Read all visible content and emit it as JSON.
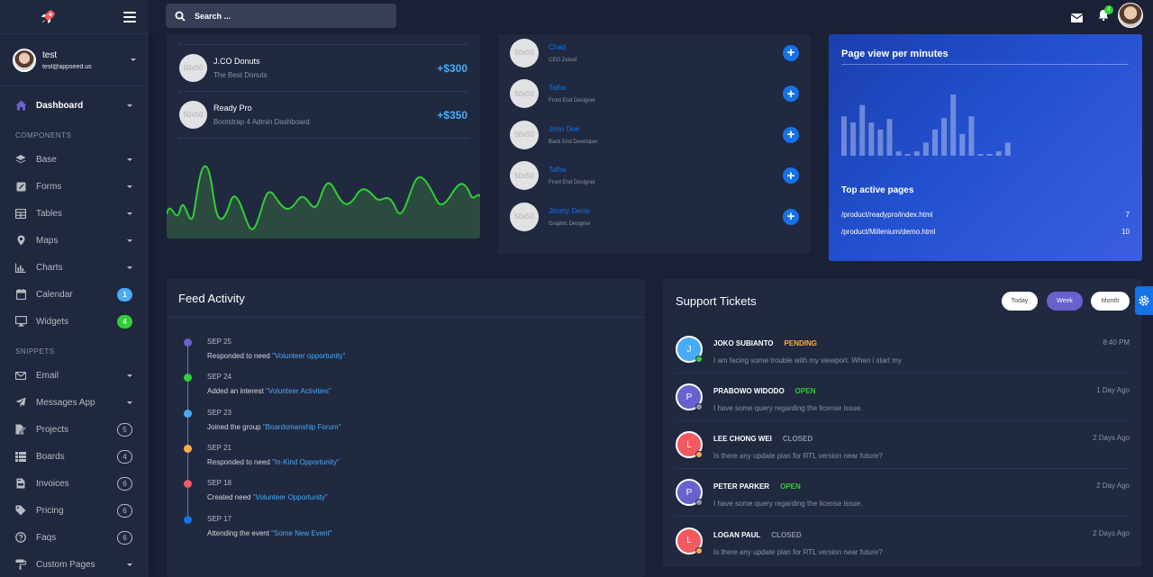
{
  "sidebar": {
    "user": {
      "name": "test",
      "email": "test@appseed.us"
    },
    "items": [
      {
        "label": "Dashboard",
        "icon": "home-icon",
        "active": true
      },
      {
        "section": "COMPONENTS"
      },
      {
        "label": "Base",
        "icon": "layers-icon"
      },
      {
        "label": "Forms",
        "icon": "pen-square-icon"
      },
      {
        "label": "Tables",
        "icon": "table-icon"
      },
      {
        "label": "Maps",
        "icon": "map-marker-icon"
      },
      {
        "label": "Charts",
        "icon": "bar-chart-icon"
      },
      {
        "label": "Calendar",
        "icon": "calendar-icon",
        "badge": "1",
        "badge_color": "#48abf7"
      },
      {
        "label": "Widgets",
        "icon": "desktop-icon",
        "badge": "4",
        "badge_color": "#31ce36"
      },
      {
        "section": "SNIPPETS"
      },
      {
        "label": "Email",
        "icon": "envelope-icon"
      },
      {
        "label": "Messages App",
        "icon": "paper-plane-icon"
      },
      {
        "label": "Projects",
        "icon": "file-signature-icon",
        "badge_outline": "5"
      },
      {
        "label": "Boards",
        "icon": "th-list-icon",
        "badge_outline": "4"
      },
      {
        "label": "Invoices",
        "icon": "file-invoice-icon",
        "badge_outline": "6"
      },
      {
        "label": "Pricing",
        "icon": "tag-icon",
        "badge_outline": "6"
      },
      {
        "label": "Faqs",
        "icon": "question-circle-icon",
        "badge_outline": "6"
      },
      {
        "label": "Custom Pages",
        "icon": "paint-roller-icon"
      }
    ]
  },
  "topbar": {
    "search_placeholder": "Search ...",
    "notification_count": "4"
  },
  "sales": {
    "items": [
      {
        "title": "J.CO Donuts",
        "subtitle": "The Best Donuts",
        "amount": "+$300"
      },
      {
        "title": "Ready Pro",
        "subtitle": "Bootstrap 4 Admin Dashboard",
        "amount": "+$350"
      }
    ],
    "placeholder_text": "50x50",
    "chart_color": "#31ce36"
  },
  "users": [
    {
      "name": "Chad",
      "role": "CEO Zeleaf"
    },
    {
      "name": "Talha",
      "role": "Front End Designer"
    },
    {
      "name": "John Doe",
      "role": "Back End Developer"
    },
    {
      "name": "Talha",
      "role": "Front End Designer"
    },
    {
      "name": "Jimmy Denis",
      "role": "Graphic Designer"
    }
  ],
  "page_views": {
    "title": "Page view per minutes",
    "bars": [
      45,
      38,
      58,
      38,
      30,
      42,
      5,
      2,
      5,
      15,
      30,
      43,
      70,
      25,
      45,
      2,
      2,
      5,
      15
    ],
    "top_title": "Top active pages",
    "pages": [
      {
        "path": "/product/readypro/index.html",
        "count": "7"
      },
      {
        "path": "/product/Millenium/demo.html",
        "count": "10"
      }
    ]
  },
  "feed": {
    "title": "Feed Activity",
    "items": [
      {
        "date": "SEP 25",
        "text": "Responded to need ",
        "link": "\"Volunteer opportunity\"",
        "color": "#6861ce"
      },
      {
        "date": "SEP 24",
        "text": "Added an interest ",
        "link": "\"Volunteer Activities\"",
        "color": "#31ce36"
      },
      {
        "date": "SEP 23",
        "text": "Joined the group ",
        "link": "\"Boardsmanship Forum\"",
        "color": "#48abf7"
      },
      {
        "date": "SEP 21",
        "text": "Responded to need ",
        "link": "\"In-Kind Opportunity\"",
        "color": "#ffad46"
      },
      {
        "date": "SEP 18",
        "text": "Created need ",
        "link": "\"Volunteer Opportunity\"",
        "color": "#f25961"
      },
      {
        "date": "SEP 17",
        "text": "Attending the event ",
        "link": "\"Some New Event\"",
        "color": "#1572e8"
      }
    ]
  },
  "tickets": {
    "title": "Support Tickets",
    "tabs": [
      "Today",
      "Week",
      "Month"
    ],
    "rows": [
      {
        "initial": "J",
        "name": "JOKO SUBIANTO",
        "status": "PENDING",
        "status_color": "#ffad46",
        "message": "I am facing some trouble with my viewport. When i start my",
        "time": "8:40 PM",
        "avatar_color": "#48abf7",
        "dot_color": "#31ce36"
      },
      {
        "initial": "P",
        "name": "PRABOWO WIDODO",
        "status": "OPEN",
        "status_color": "#31ce36",
        "message": "I have some query regarding the license issue.",
        "time": "1 Day Ago",
        "avatar_color": "#6861ce",
        "dot_color": "#8b92a9"
      },
      {
        "initial": "L",
        "name": "LEE CHONG WEI",
        "status": "CLOSED",
        "status_color": "#8b92a9",
        "message": "Is there any update plan for RTL version near future?",
        "time": "2 Days Ago",
        "avatar_color": "#f25961",
        "dot_color": "#ffad46"
      },
      {
        "initial": "P",
        "name": "PETER PARKER",
        "status": "OPEN",
        "status_color": "#31ce36",
        "message": "I have some query regarding the license issue.",
        "time": "2 Day Ago",
        "avatar_color": "#6861ce",
        "dot_color": "#8b92a9"
      },
      {
        "initial": "L",
        "name": "LOGAN PAUL",
        "status": "CLOSED",
        "status_color": "#8b92a9",
        "message": "Is there any update plan for RTL version near future?",
        "time": "2 Days Ago",
        "avatar_color": "#f25961",
        "dot_color": "#ffad46"
      }
    ]
  }
}
